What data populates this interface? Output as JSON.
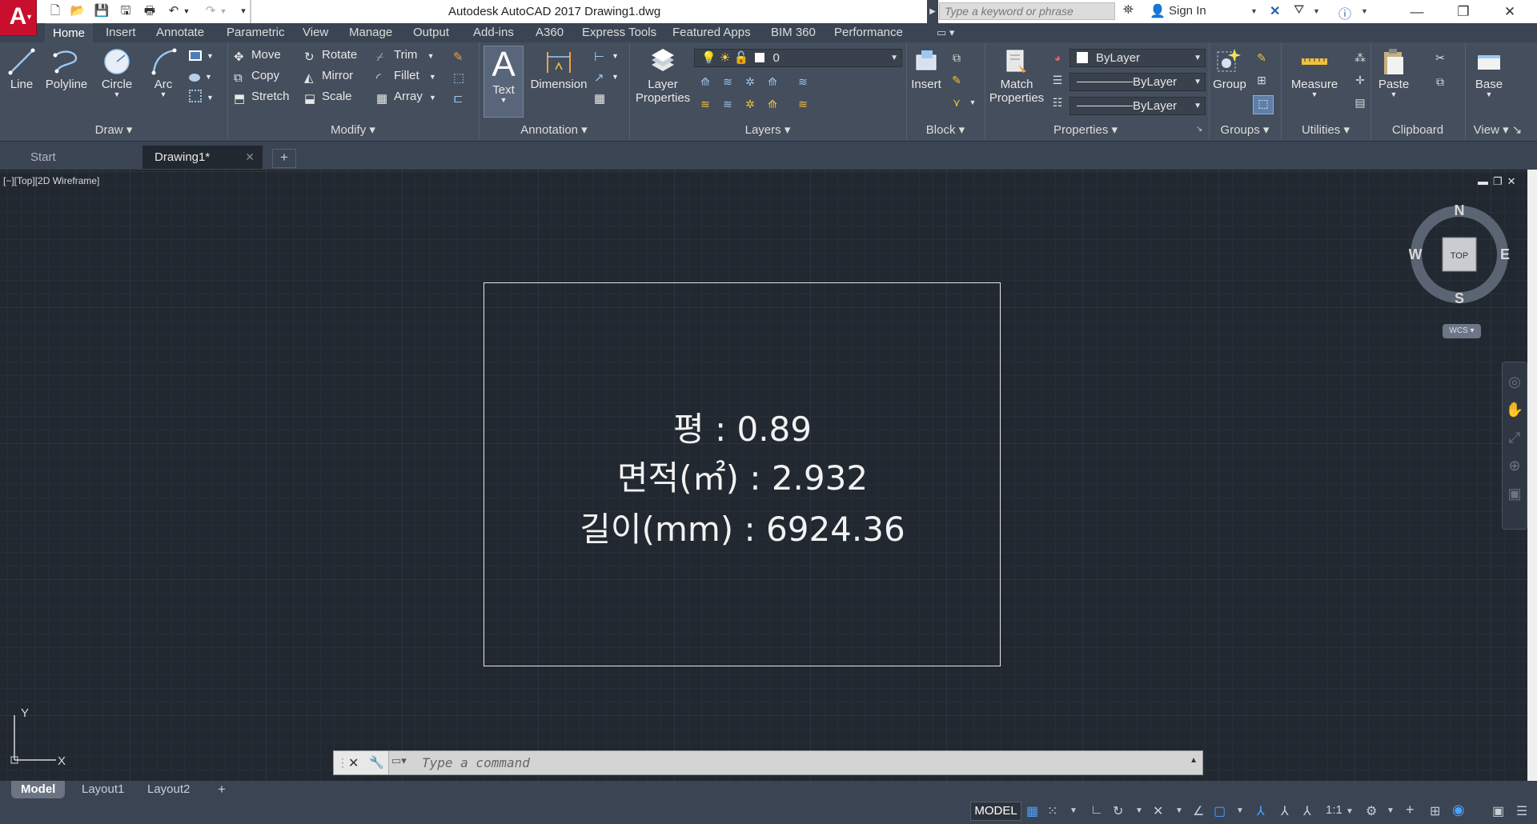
{
  "window": {
    "title": "Autodesk AutoCAD 2017    Drawing1.dwg",
    "search_placeholder": "Type a keyword or phrase",
    "sign_in": "Sign In"
  },
  "ribbon_tabs": [
    "Home",
    "Insert",
    "Annotate",
    "Parametric",
    "View",
    "Manage",
    "Output",
    "Add-ins",
    "A360",
    "Express Tools",
    "Featured Apps",
    "BIM 360",
    "Performance"
  ],
  "panels": {
    "draw": {
      "label": "Draw",
      "line": "Line",
      "polyline": "Polyline",
      "circle": "Circle",
      "arc": "Arc"
    },
    "modify": {
      "label": "Modify",
      "move": "Move",
      "rotate": "Rotate",
      "trim": "Trim",
      "copy": "Copy",
      "mirror": "Mirror",
      "fillet": "Fillet",
      "stretch": "Stretch",
      "scale": "Scale",
      "array": "Array"
    },
    "annotation": {
      "label": "Annotation",
      "text": "Text",
      "dimension": "Dimension"
    },
    "layers": {
      "label": "Layers",
      "layer_properties_1": "Layer",
      "layer_properties_2": "Properties",
      "current_layer": "0"
    },
    "block": {
      "label": "Block",
      "insert": "Insert"
    },
    "properties": {
      "label": "Properties",
      "match_1": "Match",
      "match_2": "Properties",
      "color": "ByLayer",
      "linetype": "ByLayer",
      "lineweight": "ByLayer"
    },
    "groups": {
      "label": "Groups",
      "group": "Group"
    },
    "utilities": {
      "label": "Utilities",
      "measure": "Measure"
    },
    "clipboard": {
      "label": "Clipboard",
      "paste": "Paste"
    },
    "view": {
      "label": "View",
      "base": "Base"
    }
  },
  "file_tabs": [
    "Start",
    "Drawing1*"
  ],
  "viewport_label": "[−][Top][2D Wireframe]",
  "drawing": {
    "line1": "평 : 0.89",
    "line2": "면적(㎡) : 2.932",
    "line3": "길이(mm) : 6924.36"
  },
  "viewcube": {
    "n": "N",
    "s": "S",
    "e": "E",
    "w": "W",
    "face": "TOP",
    "wcs": "WCS"
  },
  "ucs": {
    "x": "X",
    "y": "Y"
  },
  "command": {
    "placeholder": "Type a command"
  },
  "layout_tabs": [
    "Model",
    "Layout1",
    "Layout2"
  ],
  "status": {
    "model": "MODEL",
    "scale": "1:1"
  },
  "colors": {
    "accent_red": "#c8102e",
    "ribbon": "#444e5c",
    "canvas": "#212830",
    "active_blue": "#4aa3ff"
  }
}
